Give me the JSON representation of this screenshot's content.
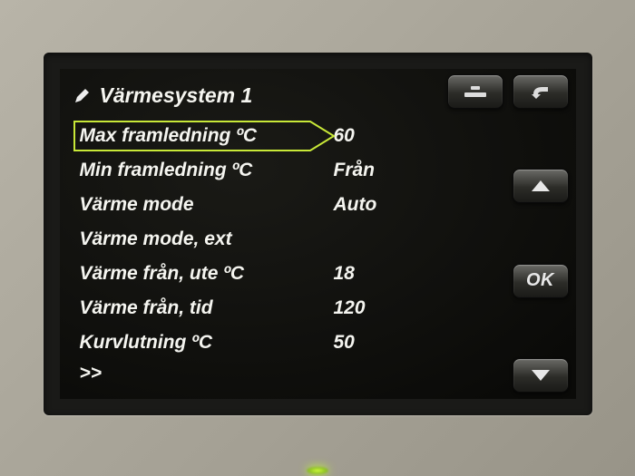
{
  "title": "Värmesystem 1",
  "menu": [
    {
      "label": "Max framledning ºC",
      "value": "60",
      "selected": true
    },
    {
      "label": "Min framledning ºC",
      "value": "Från",
      "selected": false
    },
    {
      "label": "Värme mode",
      "value": "Auto",
      "selected": false
    },
    {
      "label": "Värme mode, ext",
      "value": "",
      "selected": false
    },
    {
      "label": "Värme från, ute ºC",
      "value": "18",
      "selected": false
    },
    {
      "label": "Värme från, tid",
      "value": "120",
      "selected": false
    },
    {
      "label": "Kurvlutning ºC",
      "value": "50",
      "selected": false
    }
  ],
  "more_indicator": ">>",
  "buttons": {
    "help": "?",
    "back": "↩",
    "up": "▲",
    "ok": "OK",
    "down": "▼"
  }
}
